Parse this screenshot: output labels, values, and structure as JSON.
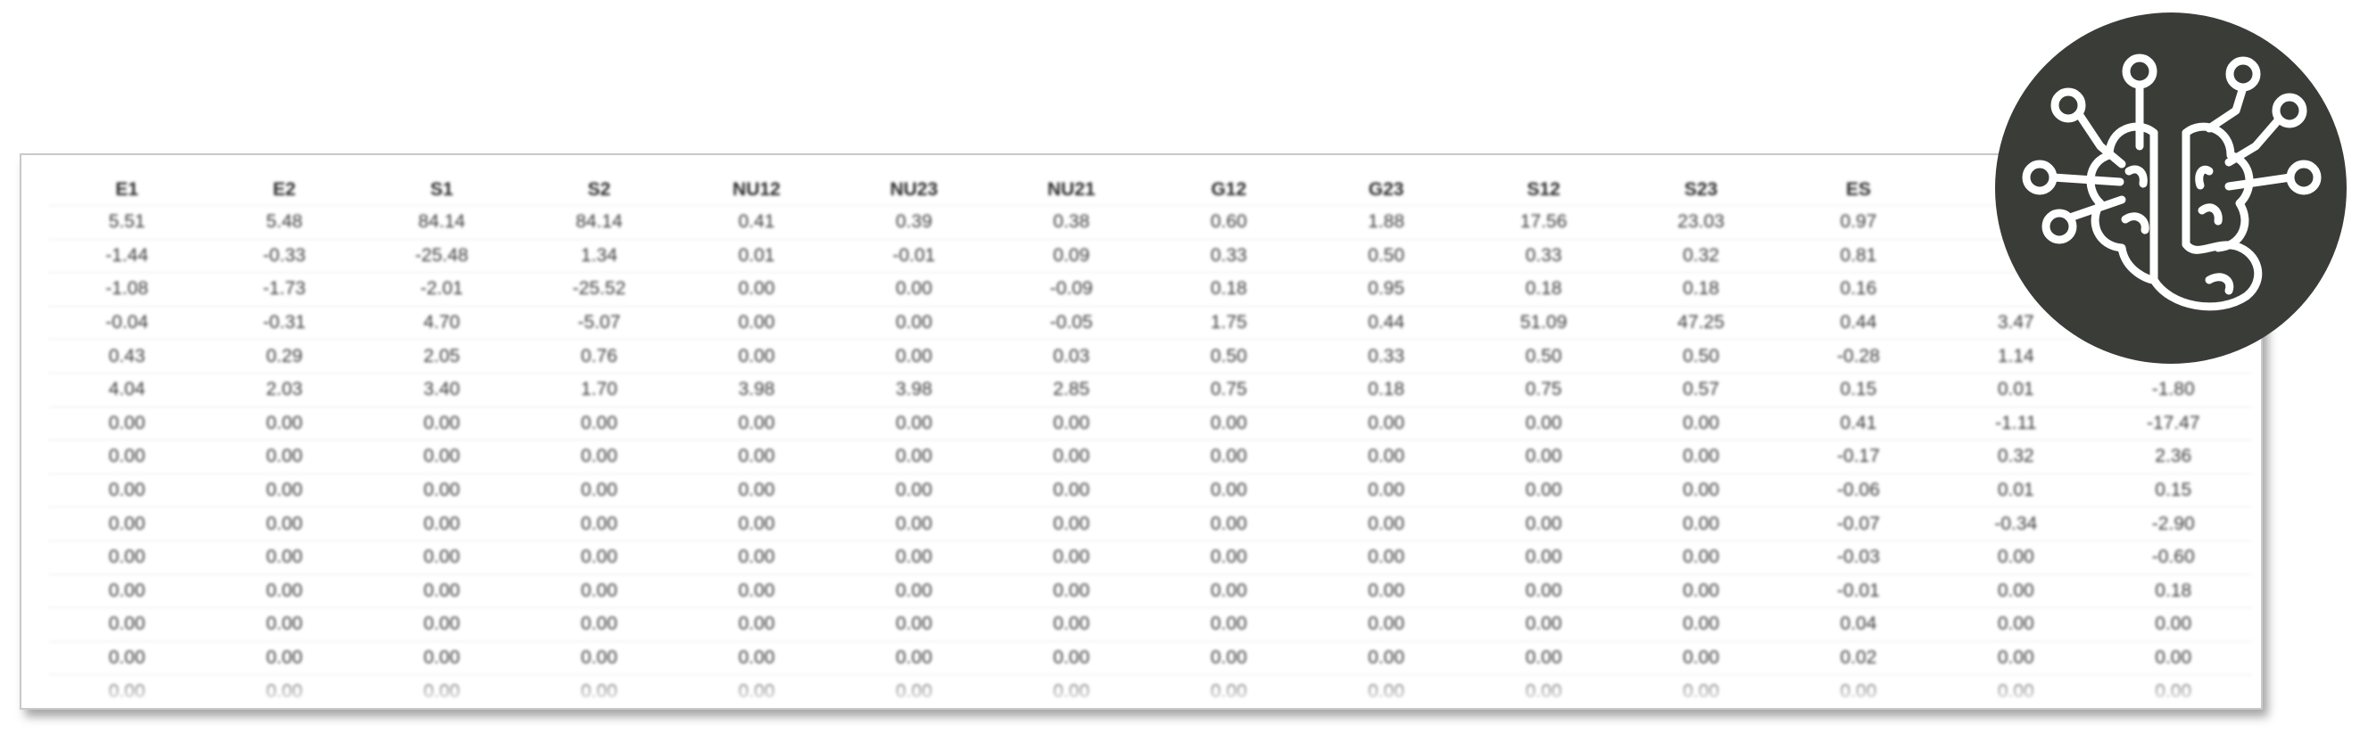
{
  "table": {
    "headers": [
      "E1",
      "E2",
      "S1",
      "S2",
      "NU12",
      "NU23",
      "NU21",
      "G12",
      "G23",
      "S12",
      "S23",
      "ES",
      "",
      ""
    ],
    "rows": [
      [
        "5.51",
        "5.48",
        "84.14",
        "84.14",
        "0.41",
        "0.39",
        "0.38",
        "0.60",
        "1.88",
        "17.56",
        "23.03",
        "0.97",
        "",
        ""
      ],
      [
        "-1.44",
        "-0.33",
        "-25.48",
        "1.34",
        "0.01",
        "-0.01",
        "0.09",
        "0.33",
        "0.50",
        "0.33",
        "0.32",
        "0.81",
        "",
        ""
      ],
      [
        "-1.08",
        "-1.73",
        "-2.01",
        "-25.52",
        "0.00",
        "0.00",
        "-0.09",
        "0.18",
        "0.95",
        "0.18",
        "0.18",
        "0.16",
        "",
        ""
      ],
      [
        "-0.04",
        "-0.31",
        "4.70",
        "-5.07",
        "0.00",
        "0.00",
        "-0.05",
        "1.75",
        "0.44",
        "51.09",
        "47.25",
        "0.44",
        "3.47",
        ""
      ],
      [
        "0.43",
        "0.29",
        "2.05",
        "0.76",
        "0.00",
        "0.00",
        "0.03",
        "0.50",
        "0.33",
        "0.50",
        "0.50",
        "-0.28",
        "1.14",
        ""
      ],
      [
        "4.04",
        "2.03",
        "3.40",
        "1.70",
        "3.98",
        "3.98",
        "2.85",
        "0.75",
        "0.18",
        "0.75",
        "0.57",
        "0.15",
        "0.01",
        "-1.80"
      ],
      [
        "0.00",
        "0.00",
        "0.00",
        "0.00",
        "0.00",
        "0.00",
        "0.00",
        "0.00",
        "0.00",
        "0.00",
        "0.00",
        "0.41",
        "-1.11",
        "-17.47"
      ],
      [
        "0.00",
        "0.00",
        "0.00",
        "0.00",
        "0.00",
        "0.00",
        "0.00",
        "0.00",
        "0.00",
        "0.00",
        "0.00",
        "-0.17",
        "0.32",
        "2.36"
      ],
      [
        "0.00",
        "0.00",
        "0.00",
        "0.00",
        "0.00",
        "0.00",
        "0.00",
        "0.00",
        "0.00",
        "0.00",
        "0.00",
        "-0.06",
        "0.01",
        "0.15"
      ],
      [
        "0.00",
        "0.00",
        "0.00",
        "0.00",
        "0.00",
        "0.00",
        "0.00",
        "0.00",
        "0.00",
        "0.00",
        "0.00",
        "-0.07",
        "-0.34",
        "-2.90"
      ],
      [
        "0.00",
        "0.00",
        "0.00",
        "0.00",
        "0.00",
        "0.00",
        "0.00",
        "0.00",
        "0.00",
        "0.00",
        "0.00",
        "-0.03",
        "0.00",
        "-0.60"
      ],
      [
        "0.00",
        "0.00",
        "0.00",
        "0.00",
        "0.00",
        "0.00",
        "0.00",
        "0.00",
        "0.00",
        "0.00",
        "0.00",
        "-0.01",
        "0.00",
        "0.18"
      ],
      [
        "0.00",
        "0.00",
        "0.00",
        "0.00",
        "0.00",
        "0.00",
        "0.00",
        "0.00",
        "0.00",
        "0.00",
        "0.00",
        "0.04",
        "0.00",
        "0.00"
      ],
      [
        "0.00",
        "0.00",
        "0.00",
        "0.00",
        "0.00",
        "0.00",
        "0.00",
        "0.00",
        "0.00",
        "0.00",
        "0.00",
        "0.02",
        "0.00",
        "0.00"
      ],
      [
        "0.00",
        "0.00",
        "0.00",
        "0.00",
        "0.00",
        "0.00",
        "0.00",
        "0.00",
        "0.00",
        "0.00",
        "0.00",
        "0.00",
        "0.00",
        "0.00"
      ]
    ]
  },
  "logo": {
    "icon": "brain-circuit-icon",
    "background_color": "#3a3c37",
    "foreground_color": "#ffffff"
  }
}
